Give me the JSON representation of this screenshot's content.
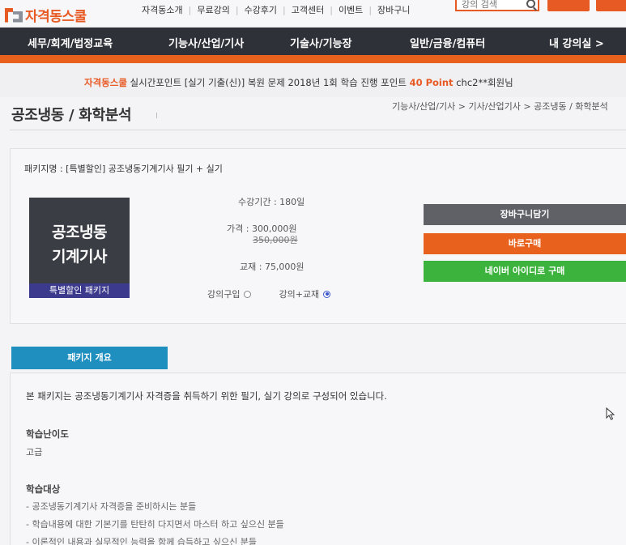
{
  "brand": {
    "name": "자격동스쿨"
  },
  "topnav": {
    "links": [
      "자격동소개",
      "무료강의",
      "수강후기",
      "고객센터",
      "이벤트",
      "장바구니"
    ],
    "search_placeholder": "강의 검색"
  },
  "mainnav": {
    "items": [
      "세무/회계/법정교육",
      "기능사/산업/기사",
      "기술사/기능장",
      "일반/금융/컴퓨터",
      "내 강의실 >"
    ]
  },
  "ticker": {
    "brand": "자격동스쿨",
    "text": " 실시간포인트 [실기 기출(신)] 복원 문제 2018년 1회 학습 진행 포인트 ",
    "point": "40 Point",
    "user": " chc2**회원님"
  },
  "page": {
    "title": "공조냉동 / 화학분석",
    "title_sep": "I",
    "breadcrumb": "기능사/산업/기사 > 기사/산업기사 > 공조냉동 / 화학분석"
  },
  "package": {
    "name_line": "패키지명 : [특별할인] 공조냉동기계기사 필기 + 실기",
    "thumb_line1": "공조냉동",
    "thumb_line2": "기계기사",
    "thumb_badge": "특별할인 패키지",
    "period": "수강기간 : 180일",
    "price": "가격 : 300,000원",
    "original_price": "350,000원",
    "textbook": "교재 : 75,000원",
    "option_lecture": "강의구입",
    "option_lecture_textbook": "강의+교재",
    "selected_option": "강의+교재"
  },
  "buttons": {
    "cart": "장바구니담기",
    "buy": "바로구매",
    "naver": "네이버 아이디로 구매"
  },
  "overview": {
    "tab": "패키지 개요",
    "description": "본 패키지는 공조냉동기계기사 자격증을 취득하기 위한 필기, 실기 강의로 구성되어 있습니다.",
    "difficulty_label": "학습난이도",
    "difficulty_value": "고급",
    "target_label": "학습대상",
    "target_items": [
      "- 공조냉동기계기사 자격증을 준비하시는 분들",
      "- 학습내용에 대한 기본기를 탄탄히 다지면서 마스터 하고 싶으신 분들",
      "- 이론적인 내용과 실무적인 능력을 함께 습득하고 싶으신 분들"
    ]
  },
  "colors": {
    "accent_orange": "#e8621d",
    "nav_dark": "#2f3138",
    "naver_green": "#3cb33c",
    "tab_blue": "#1f8fbf",
    "badge_purple": "#3c3a8c"
  }
}
